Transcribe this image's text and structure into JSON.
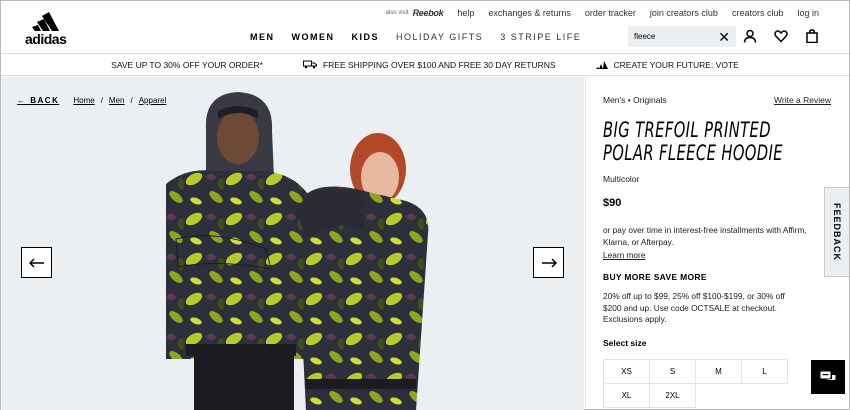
{
  "brand": {
    "logo_text": "adidas"
  },
  "util": {
    "also_visit": "also visit",
    "reebok": "Reebok",
    "links": [
      "help",
      "exchanges & returns",
      "order tracker",
      "join creators club",
      "creators club",
      "log in"
    ]
  },
  "nav": {
    "items": [
      "MEN",
      "WOMEN",
      "KIDS",
      "HOLIDAY GIFTS",
      "3 STRIPE LIFE"
    ]
  },
  "search": {
    "value": "fleece"
  },
  "promo": {
    "items": [
      "SAVE UP TO 30% OFF YOUR ORDER*",
      "FREE SHIPPING OVER $100 AND FREE 30 DAY RETURNS",
      "CREATE YOUR FUTURE: VOTE"
    ]
  },
  "breadcrumb": {
    "back": "BACK",
    "items": [
      "Home",
      "Men",
      "Apparel"
    ],
    "sep": "/"
  },
  "product": {
    "category": "Men's • Originals",
    "write_review": "Write a Review",
    "title_line1": "BIG TREFOIL PRINTED",
    "title_line2": "POLAR FLEECE HOODIE",
    "color": "Multicolor",
    "price": "$90",
    "installments": "or pay over time in interest-free installments with Affirm, Klarna, or Afterpay.",
    "learn_more": "Learn more",
    "buy_more": "BUY MORE SAVE MORE",
    "promo_text": "20% off up to $99, 25% off $100-$199, or 30% off $200 and up. Use code OCTSALE at checkout. Exclusions apply.",
    "select_size": "Select size",
    "sizes": [
      "XS",
      "S",
      "M",
      "L",
      "XL",
      "2XL"
    ]
  },
  "feedback": "FEEDBACK",
  "icons": [
    "user-icon",
    "heart-icon",
    "bag-icon",
    "arrow-left-icon",
    "arrow-right-icon",
    "chat-icon"
  ]
}
